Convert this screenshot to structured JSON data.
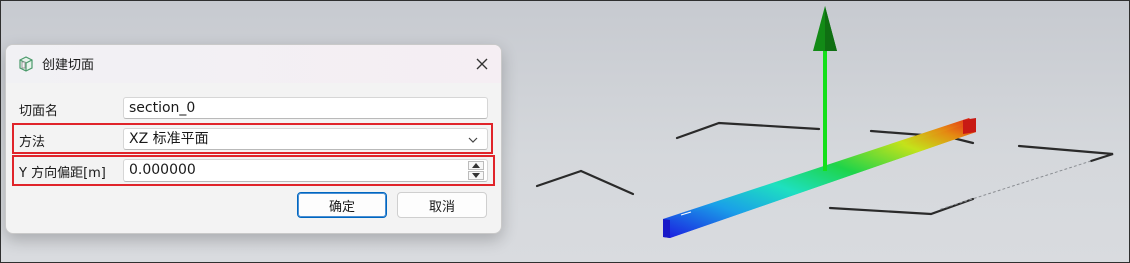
{
  "dialog": {
    "title": "创建切面",
    "icon": "section-plane-icon",
    "fields": {
      "name_label": "切面名",
      "name_value": "section_0",
      "method_label": "方法",
      "method_value": "XZ 标准平面",
      "offset_label": "Y 方向偏距[m]",
      "offset_value": "0.000000"
    },
    "buttons": {
      "ok": "确定",
      "cancel": "取消"
    }
  },
  "viewport": {
    "beam_gradient": [
      "#1b1fe0",
      "#1aa0e8",
      "#1ee0c0",
      "#1ed44a",
      "#c4e21a",
      "#e58a12",
      "#e3261a"
    ],
    "axis_color": "#14c41a",
    "plane_color": "#2a2a2a",
    "highlight_color": "#e0242a"
  }
}
